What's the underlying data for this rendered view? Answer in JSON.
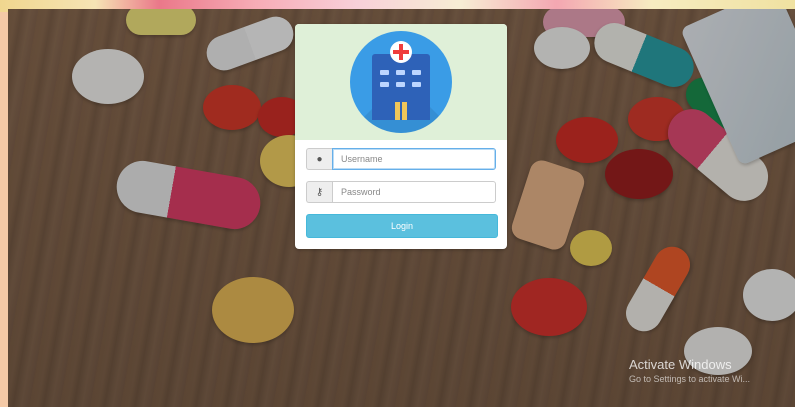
{
  "form": {
    "username_placeholder": "Username",
    "password_placeholder": "Password",
    "login_label": "Login",
    "user_icon": "user-icon",
    "key_icon": "key-icon"
  },
  "watermark": {
    "title": "Activate Windows",
    "subtitle": "Go to Settings to activate Wi..."
  },
  "colors": {
    "panel_header": "#dff0d8",
    "logo_circle": "#3a9ce6",
    "building": "#2e62b8",
    "cross": "#ef3c3c",
    "login_button": "#5bc0de"
  }
}
